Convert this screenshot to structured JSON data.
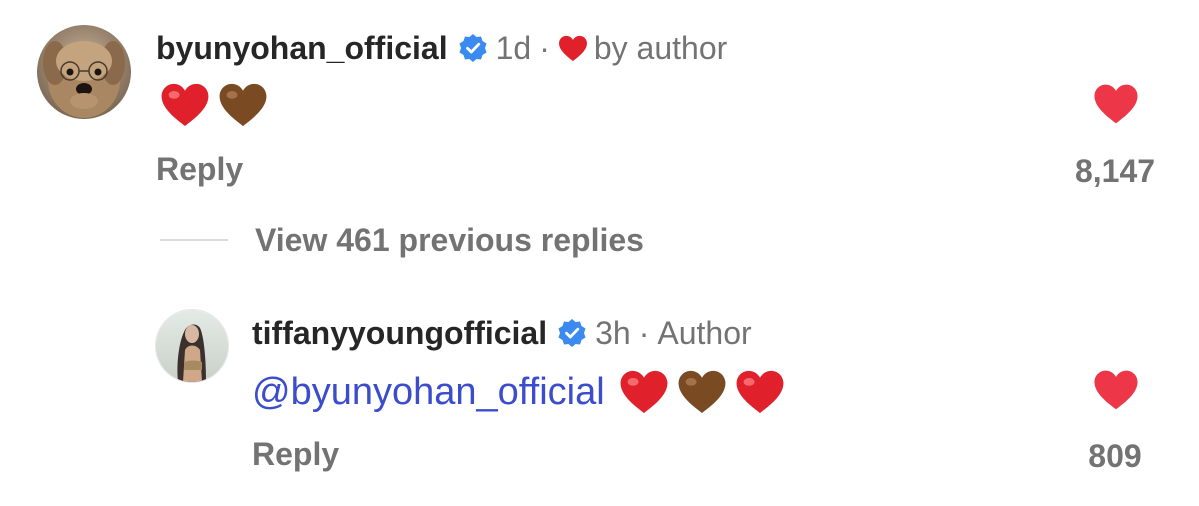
{
  "comments": [
    {
      "username": "byunyohan_official",
      "verified": true,
      "time": "1d",
      "dot": "·",
      "author_label": "by author",
      "author_heart_icon": "red-heart-icon",
      "body_emojis": [
        "red-heart",
        "brown-heart"
      ],
      "reply_label": "Reply",
      "like_count": "8,147",
      "avatar": "dog-with-glasses-avatar"
    },
    {
      "username": "tiffanyyoungofficial",
      "verified": true,
      "time": "3h",
      "dot": "·",
      "author_label": "Author",
      "mention": "@byunyohan_official",
      "body_emojis": [
        "red-heart",
        "brown-heart",
        "red-heart"
      ],
      "reply_label": "Reply",
      "like_count": "809",
      "avatar": "woman-portrait-avatar"
    }
  ],
  "view_replies_label": "View 461 previous replies",
  "colors": {
    "red_heart": "#e0202a",
    "brown_heart": "#7a4a23",
    "like_heart": "#ed3748",
    "verified_blue": "#3b8af0",
    "mention": "#3b4dcc",
    "muted_text": "#737373"
  }
}
